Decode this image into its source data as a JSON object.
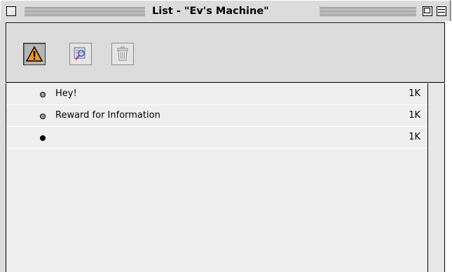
{
  "window": {
    "title": "List - \"Ev's Machine\""
  },
  "toolbar": {
    "buttons": [
      {
        "icon": "warning-icon",
        "state": "pressed"
      },
      {
        "icon": "find-icon",
        "state": "normal"
      },
      {
        "icon": "trash-icon",
        "state": "disabled"
      }
    ]
  },
  "messages": [
    {
      "subject": "Hey!",
      "size": "1K",
      "status": "unread"
    },
    {
      "subject": "Reward for Information",
      "size": "1K",
      "status": "unread"
    },
    {
      "subject": "",
      "size": "1K",
      "status": "read"
    }
  ],
  "colors": {
    "warning": "#f7931e",
    "chrome": "#dcdcdc",
    "list_bg": "#efefef"
  }
}
